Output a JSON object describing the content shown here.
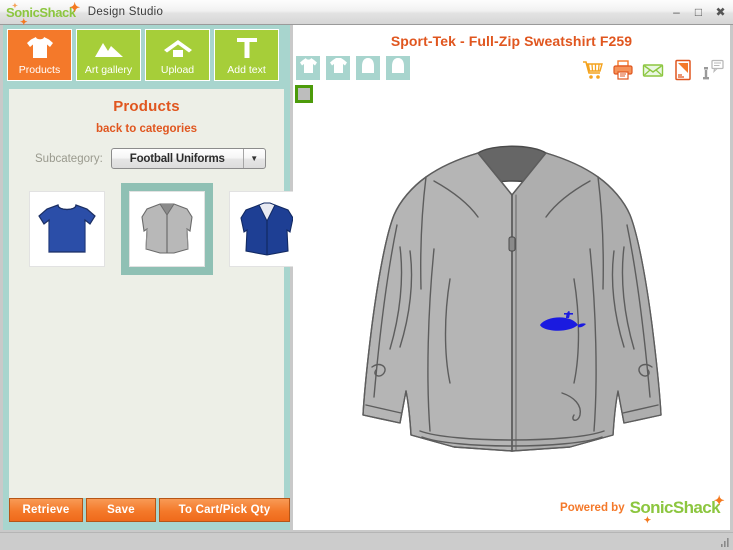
{
  "window": {
    "brand": {
      "part1": "Sonic",
      "part2": "Shack"
    },
    "title": "Design Studio",
    "controls": [
      {
        "name": "minimize",
        "glyph": "–"
      },
      {
        "name": "maximize",
        "glyph": "□"
      },
      {
        "name": "close",
        "glyph": "✖"
      }
    ]
  },
  "nav": {
    "items": [
      {
        "label": "Products",
        "icon": "tshirt-icon",
        "state": "active"
      },
      {
        "label": "Art gallery",
        "icon": "mountains-icon",
        "state": "normal"
      },
      {
        "label": "Upload",
        "icon": "upload-icon",
        "state": "normal"
      },
      {
        "label": "Add text",
        "icon": "text-t-icon",
        "state": "normal"
      }
    ]
  },
  "sidebar": {
    "title": "Products",
    "back_link": "back to categories",
    "subcategory_label": "Subcategory:",
    "subcategory_value": "Football Uniforms",
    "subcategory_options": [
      "Football Uniforms"
    ],
    "products": [
      {
        "name": "blue-tshirt",
        "type": "tshirt",
        "color": "#2b4ea8",
        "selected": false
      },
      {
        "name": "gray-jacket",
        "type": "jacket",
        "color": "#b2b2b2",
        "selected": true
      },
      {
        "name": "blue-hoodie",
        "type": "hoodie",
        "color": "#1e3f94",
        "selected": false
      }
    ],
    "buttons": [
      {
        "label": "Retrieve",
        "name": "retrieve-button"
      },
      {
        "label": "Save",
        "name": "save-button"
      },
      {
        "label": "To Cart/Pick Qty",
        "name": "to-cart-button"
      }
    ]
  },
  "design": {
    "title": "Sport-Tek - Full-Zip Sweatshirt F259",
    "views": [
      {
        "name": "view-front",
        "icon": "shirt-front-icon"
      },
      {
        "name": "view-back",
        "icon": "shirt-back-icon"
      },
      {
        "name": "view-left-sleeve",
        "icon": "sleeve-left-icon"
      },
      {
        "name": "view-right-sleeve",
        "icon": "sleeve-right-icon"
      }
    ],
    "swatch": {
      "name": "color-swatch-gray",
      "color": "#bdbdbd",
      "selected": true
    },
    "actions": [
      {
        "name": "cart-icon",
        "title": "Add to cart"
      },
      {
        "name": "print-icon",
        "title": "Print"
      },
      {
        "name": "email-icon",
        "title": "Email"
      },
      {
        "name": "edit-icon",
        "title": "Edit"
      },
      {
        "name": "info-icon",
        "title": "Info"
      }
    ],
    "garment": {
      "name": "full-zip-sweatshirt",
      "body_color": "#b5b5b5",
      "shade_color": "#a3a3a3",
      "collar_color": "#616161",
      "line_color": "#5d5d5d",
      "art": {
        "name": "whale-art",
        "color": "#1a1ae0"
      }
    },
    "powered_by": {
      "text": "Powered by",
      "brand1": "Sonic",
      "brand2": "Shack"
    }
  }
}
